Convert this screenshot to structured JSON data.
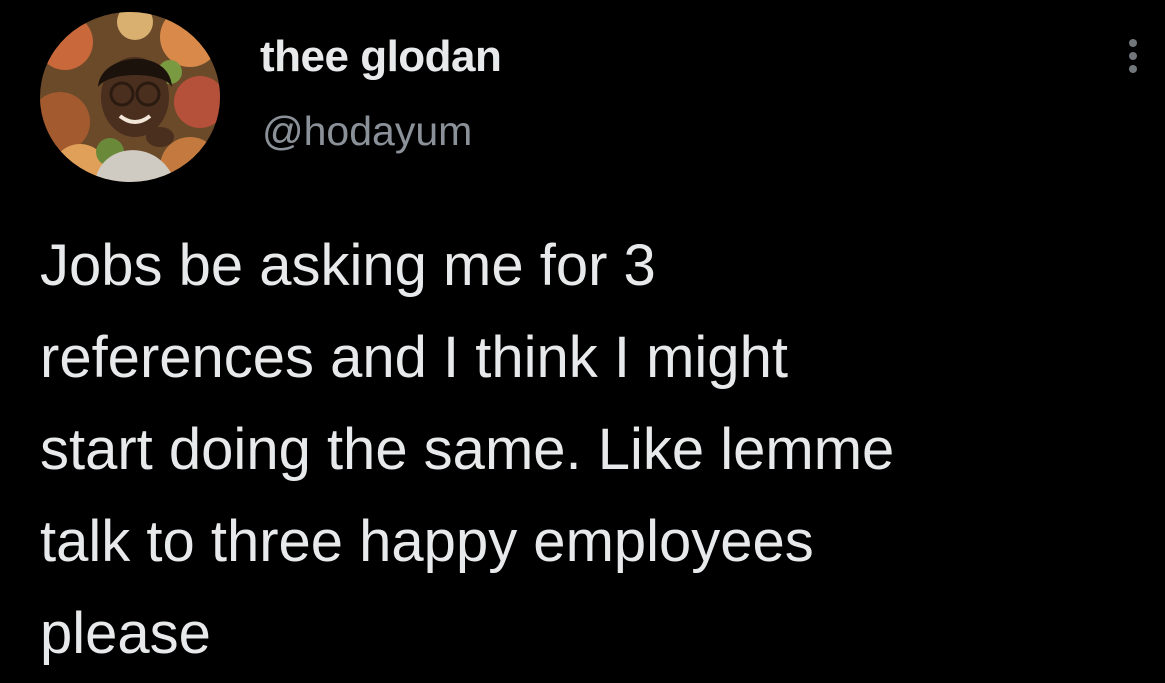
{
  "author": {
    "display_name": "thee glodan",
    "handle": "@hodayum",
    "avatar_icon": "profile-photo"
  },
  "menu": {
    "icon": "more-options-icon"
  },
  "tweet": {
    "lines": [
      "Jobs be asking me for 3",
      "references and I think I might",
      "start doing the same. Like lemme",
      "talk to three happy employees",
      "please"
    ]
  },
  "colors": {
    "background": "#000000",
    "primary_text": "#e7e9ea",
    "secondary_text": "#8b9198"
  }
}
